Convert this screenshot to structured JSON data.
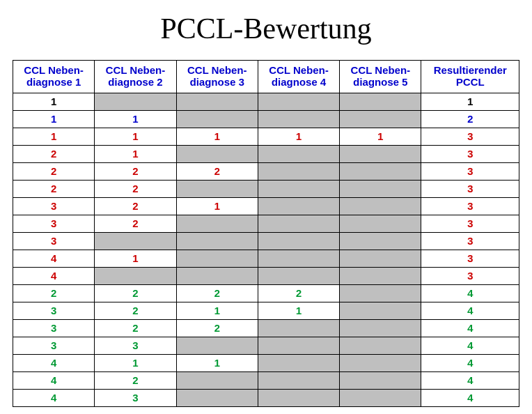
{
  "title": "PCCL-Bewertung",
  "headers": [
    {
      "l1": "CCL Neben-",
      "l2": "diagnose 1"
    },
    {
      "l1": "CCL Neben-",
      "l2": "diagnose 2"
    },
    {
      "l1": "CCL Neben-",
      "l2": "diagnose 3"
    },
    {
      "l1": "CCL Neben-",
      "l2": "diagnose 4"
    },
    {
      "l1": "CCL Neben-",
      "l2": "diagnose 5"
    },
    {
      "l1": "Resultierender",
      "l2": "PCCL"
    }
  ],
  "rows": [
    {
      "c": "black",
      "d": [
        "1",
        null,
        null,
        null,
        null
      ],
      "r": "1"
    },
    {
      "c": "blue",
      "d": [
        "1",
        "1",
        null,
        null,
        null
      ],
      "r": "2"
    },
    {
      "c": "red",
      "d": [
        "1",
        "1",
        "1",
        "1",
        "1"
      ],
      "r": "3"
    },
    {
      "c": "red",
      "d": [
        "2",
        "1",
        null,
        null,
        null
      ],
      "r": "3"
    },
    {
      "c": "red",
      "d": [
        "2",
        "2",
        "2",
        null,
        null
      ],
      "r": "3"
    },
    {
      "c": "red",
      "d": [
        "2",
        "2",
        null,
        null,
        null
      ],
      "r": "3"
    },
    {
      "c": "red",
      "d": [
        "3",
        "2",
        "1",
        null,
        null
      ],
      "r": "3"
    },
    {
      "c": "red",
      "d": [
        "3",
        "2",
        null,
        null,
        null
      ],
      "r": "3"
    },
    {
      "c": "red",
      "d": [
        "3",
        null,
        null,
        null,
        null
      ],
      "r": "3"
    },
    {
      "c": "red",
      "d": [
        "4",
        "1",
        null,
        null,
        null
      ],
      "r": "3"
    },
    {
      "c": "red",
      "d": [
        "4",
        null,
        null,
        null,
        null
      ],
      "r": "3"
    },
    {
      "c": "green",
      "d": [
        "2",
        "2",
        "2",
        "2",
        null
      ],
      "r": "4"
    },
    {
      "c": "green",
      "d": [
        "3",
        "2",
        "1",
        "1",
        null
      ],
      "r": "4"
    },
    {
      "c": "green",
      "d": [
        "3",
        "2",
        "2",
        null,
        null
      ],
      "r": "4"
    },
    {
      "c": "green",
      "d": [
        "3",
        "3",
        null,
        null,
        null
      ],
      "r": "4"
    },
    {
      "c": "green",
      "d": [
        "4",
        "1",
        "1",
        null,
        null
      ],
      "r": "4"
    },
    {
      "c": "green",
      "d": [
        "4",
        "2",
        null,
        null,
        null
      ],
      "r": "4"
    },
    {
      "c": "green",
      "d": [
        "4",
        "3",
        null,
        null,
        null
      ],
      "r": "4"
    }
  ]
}
